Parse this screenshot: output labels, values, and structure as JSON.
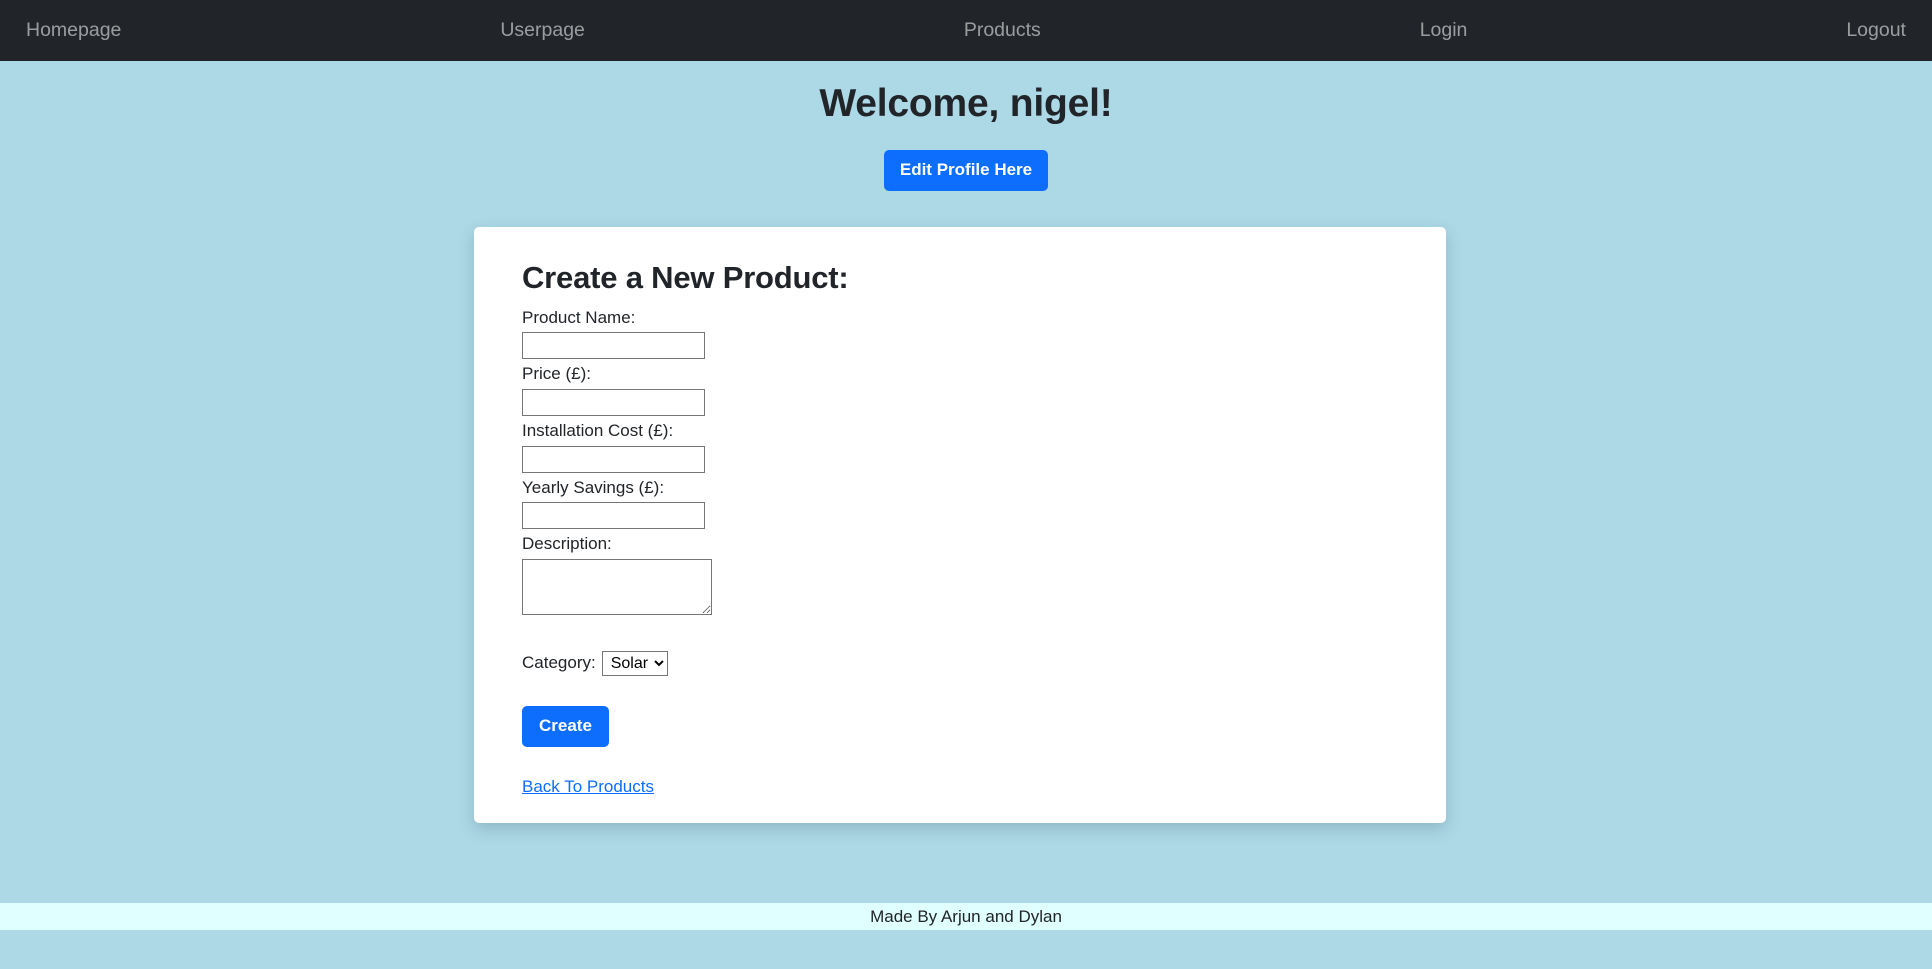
{
  "navbar": {
    "items": [
      {
        "label": "Homepage",
        "name": "nav-item-homepage"
      },
      {
        "label": "Userpage",
        "name": "nav-item-userpage"
      },
      {
        "label": "Products",
        "name": "nav-item-products"
      },
      {
        "label": "Login",
        "name": "nav-item-login"
      },
      {
        "label": "Logout",
        "name": "nav-item-logout"
      }
    ],
    "background_color": "#212529",
    "link_color": "#8d9499"
  },
  "header": {
    "welcome_title": "Welcome, nigel!",
    "edit_profile_label": "Edit Profile Here"
  },
  "card": {
    "title": "Create a New Product:",
    "fields": {
      "product_name": {
        "label": "Product Name:",
        "value": "",
        "placeholder": ""
      },
      "price": {
        "label": "Price (£):",
        "value": "",
        "placeholder": ""
      },
      "installation_cost": {
        "label": "Installation Cost (£):",
        "value": "",
        "placeholder": ""
      },
      "yearly_savings": {
        "label": "Yearly Savings (£):",
        "value": "",
        "placeholder": ""
      },
      "description": {
        "label": "Description:",
        "value": "",
        "placeholder": ""
      }
    },
    "category": {
      "label": "Category:",
      "selected": "Solar",
      "options": [
        "Solar"
      ]
    },
    "create_label": "Create",
    "back_link_label": "Back To Products"
  },
  "footer": {
    "text": "Made By Arjun and Dylan",
    "background_color": "#e0ffff"
  },
  "theme": {
    "page_background": "#add8e6",
    "primary_button": "#0d6efd",
    "link_color": "#0d6efd",
    "card_background": "#ffffff"
  }
}
